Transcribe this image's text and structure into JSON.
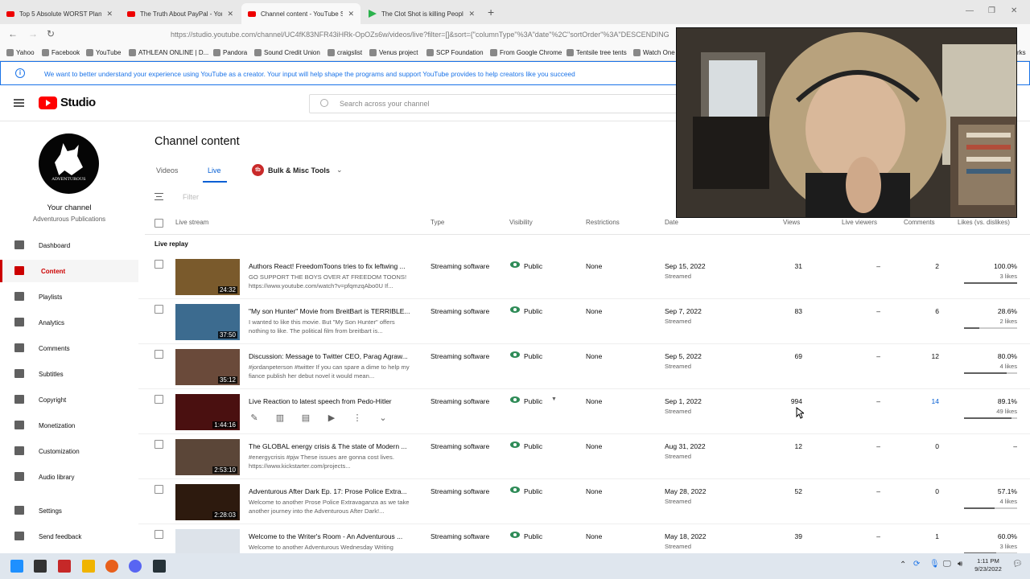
{
  "browser": {
    "tabs": [
      {
        "title": "Top 5 Absolute WORST Planeti",
        "active": false,
        "favicon": "youtube"
      },
      {
        "title": "The Truth About PayPal - YouT",
        "active": false,
        "favicon": "youtube"
      },
      {
        "title": "Channel content - YouTube Stu",
        "active": true,
        "favicon": "youtube"
      },
      {
        "title": "The Clot Shot is killing People",
        "active": false,
        "favicon": "rumble"
      }
    ],
    "url": "https://studio.youtube.com/channel/UC4fK83NFR43iHRk-OpOZs6w/videos/live?filter=[]&sort={\"columnType\"%3A\"date\"%2C\"sortOrder\"%3A\"DESCENDING",
    "bookmarks": [
      "Yahoo",
      "Facebook",
      "YouTube",
      "ATHLEAN ONLINE | D...",
      "Pandora",
      "Sound Credit Union",
      "craigslist",
      "Venus project",
      "SCP Foundation",
      "From Google Chrome",
      "Tentsile tree tents",
      "Watch One"
    ],
    "bookmarks_overflow": "rks"
  },
  "banner": {
    "text": "We want to better understand your experience using YouTube as a creator. Your input will help shape the programs and support YouTube provides to help creators like you succeed"
  },
  "header": {
    "logo_text": "Studio",
    "search_placeholder": "Search across your channel"
  },
  "sidebar": {
    "avatar_brand": "ADVENTUROUS",
    "your_channel": "Your channel",
    "channel_name": "Adventurous Publications",
    "items": [
      {
        "label": "Dashboard",
        "icon": "dashboard-icon"
      },
      {
        "label": "Content",
        "icon": "content-icon",
        "active": true
      },
      {
        "label": "Playlists",
        "icon": "playlists-icon"
      },
      {
        "label": "Analytics",
        "icon": "analytics-icon"
      },
      {
        "label": "Comments",
        "icon": "comments-icon"
      },
      {
        "label": "Subtitles",
        "icon": "subtitles-icon"
      },
      {
        "label": "Copyright",
        "icon": "copyright-icon"
      },
      {
        "label": "Monetization",
        "icon": "monetization-icon"
      },
      {
        "label": "Customization",
        "icon": "customization-icon"
      },
      {
        "label": "Audio library",
        "icon": "audio-library-icon"
      },
      {
        "label": "Settings",
        "icon": "gear-icon"
      },
      {
        "label": "Send feedback",
        "icon": "feedback-icon"
      }
    ]
  },
  "main": {
    "title": "Channel content",
    "tabs": [
      {
        "label": "Videos"
      },
      {
        "label": "Live",
        "active": true
      }
    ],
    "bulk_label": "Bulk & Misc Tools",
    "bulk_icon_text": "tb",
    "filter_placeholder": "Filter",
    "columns": [
      "Live stream",
      "Type",
      "Visibility",
      "Restrictions",
      "Date",
      "Views",
      "Live viewers",
      "Comments",
      "Likes (vs. dislikes)"
    ],
    "section_label": "Live replay",
    "rows": [
      {
        "title": "Authors React! FreedomToons tries to fix leftwing ...",
        "desc": "GO SUPPORT THE BOYS OVER AT FREEDOM TOONS! https://www.youtube.com/watch?v=pfqmzqAbo0U  If...",
        "duration": "24:32",
        "type": "Streaming software",
        "visibility": "Public",
        "restrictions": "None",
        "date": "Sep 15, 2022",
        "date_sub": "Streamed",
        "views": "31",
        "live_viewers": "–",
        "comments": "2",
        "likes_pct": "100.0%",
        "likes": "3 likes",
        "likes_ratio": 1.0
      },
      {
        "title": "\"My son Hunter\" Movie from BreitBart is TERRIBLE...",
        "desc": "I wanted to like this movie. But \"My Son Hunter\" offers nothing to like. The political film from breitbart is...",
        "duration": "37:50",
        "type": "Streaming software",
        "visibility": "Public",
        "restrictions": "None",
        "date": "Sep 7, 2022",
        "date_sub": "Streamed",
        "views": "83",
        "live_viewers": "–",
        "comments": "6",
        "likes_pct": "28.6%",
        "likes": "2 likes",
        "likes_ratio": 0.286
      },
      {
        "title": "Discussion: Message to Twitter CEO, Parag Agraw...",
        "desc": "#jordanpeterson #twitter If you can spare a dime to help my fiance publish her debut novel it would mean...",
        "duration": "35:12",
        "type": "Streaming software",
        "visibility": "Public",
        "restrictions": "None",
        "date": "Sep 5, 2022",
        "date_sub": "Streamed",
        "views": "69",
        "live_viewers": "–",
        "comments": "12",
        "likes_pct": "80.0%",
        "likes": "4 likes",
        "likes_ratio": 0.8
      },
      {
        "title": "Live Reaction to latest speech from Pedo-Hitler",
        "desc": "",
        "duration": "1:44:16",
        "type": "Streaming software",
        "visibility": "Public",
        "restrictions": "None",
        "date": "Sep 1, 2022",
        "date_sub": "Streamed",
        "views": "994",
        "live_viewers": "–",
        "comments": "14",
        "likes_pct": "89.1%",
        "likes": "49 likes",
        "likes_ratio": 0.891,
        "hovered": true
      },
      {
        "title": "The GLOBAL energy crisis & The state of Modern ...",
        "desc": "#energycrisis #pjw These issues are gonna cost lives. https://www.kickstarter.com/projects...",
        "duration": "2:53:10",
        "type": "Streaming software",
        "visibility": "Public",
        "restrictions": "None",
        "date": "Aug 31, 2022",
        "date_sub": "Streamed",
        "views": "12",
        "live_viewers": "–",
        "comments": "0",
        "likes_pct": "–",
        "likes": "",
        "likes_ratio": null
      },
      {
        "title": "Adventurous After Dark Ep. 17: Prose Police Extra...",
        "desc": "Welcome to another Prose Police Extravaganza as we take another journey into the Adventurous After Dark!...",
        "duration": "2:28:03",
        "type": "Streaming software",
        "visibility": "Public",
        "restrictions": "None",
        "date": "May 28, 2022",
        "date_sub": "Streamed",
        "views": "52",
        "live_viewers": "–",
        "comments": "0",
        "likes_pct": "57.1%",
        "likes": "4 likes",
        "likes_ratio": 0.571
      },
      {
        "title": "Welcome to the Writer's Room - An Adventurous ...",
        "desc": "Welcome to another Adventurous Wednesday Writing",
        "duration": "",
        "type": "Streaming software",
        "visibility": "Public",
        "restrictions": "None",
        "date": "May 18, 2022",
        "date_sub": "Streamed",
        "views": "39",
        "live_viewers": "–",
        "comments": "1",
        "likes_pct": "60.0%",
        "likes": "3 likes",
        "likes_ratio": 0.6
      }
    ]
  },
  "taskbar": {
    "time": "1:11 PM",
    "date": "9/23/2022"
  }
}
